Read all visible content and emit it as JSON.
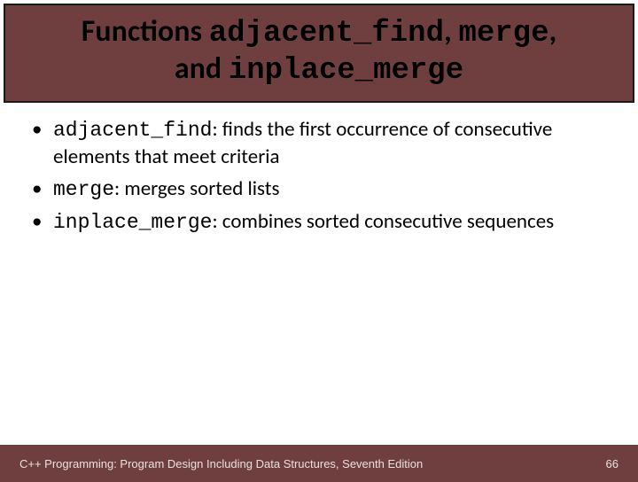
{
  "header": {
    "prefix": "Functions ",
    "code1": "adjacent_find",
    "sep1": ", ",
    "code2": "merge",
    "sep2": ",",
    "line2_prefix": "and ",
    "code3": "inplace_merge"
  },
  "bullets": [
    {
      "code": "adjacent_find",
      "rest": ": finds the first occurrence of consecutive elements that meet criteria"
    },
    {
      "code": "merge",
      "rest": ": merges sorted lists"
    },
    {
      "code": "inplace_merge",
      "rest": ": combines sorted consecutive sequences"
    }
  ],
  "footer": {
    "text": "C++ Programming: Program Design Including Data Structures, Seventh Edition",
    "page": "66"
  }
}
